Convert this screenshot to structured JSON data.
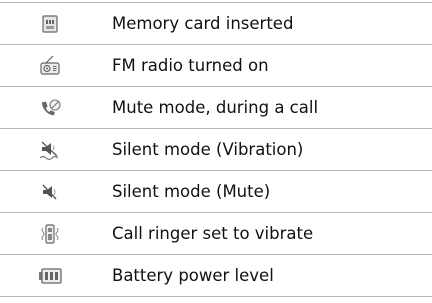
{
  "rows": [
    {
      "icon": "memory-card-icon",
      "label": "Memory card inserted"
    },
    {
      "icon": "fm-radio-icon",
      "label": "FM radio turned on"
    },
    {
      "icon": "mute-call-icon",
      "label": "Mute mode, during a call"
    },
    {
      "icon": "silent-vibration-icon",
      "label": "Silent mode (Vibration)"
    },
    {
      "icon": "silent-mute-icon",
      "label": "Silent mode (Mute)"
    },
    {
      "icon": "vibrate-ringer-icon",
      "label": "Call ringer set to vibrate"
    },
    {
      "icon": "battery-icon",
      "label": "Battery power level"
    }
  ],
  "colors": {
    "icon_dark": "#555555",
    "icon_mid": "#8a8a8a",
    "icon_light": "#bdbdbd",
    "rule": "#b8b8b8",
    "text": "#111111"
  }
}
